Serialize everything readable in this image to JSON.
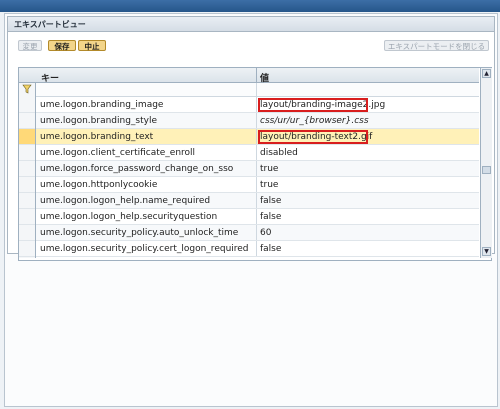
{
  "panel": {
    "title": "エキスパートビュー"
  },
  "toolbar": {
    "change_label": "変更",
    "save_label": "保存",
    "cancel_label": "中止",
    "close_expert_label": "エキスパートモードを閉じる"
  },
  "grid": {
    "columns": {
      "key": "キー",
      "value": "値"
    },
    "rows": [
      {
        "key": "ume.logon.branding_image",
        "value": "layout/branding-image2.jpg"
      },
      {
        "key": "ume.logon.branding_style",
        "value": "css/ur/ur_{browser}.css"
      },
      {
        "key": "ume.logon.branding_text",
        "value": "layout/branding-text2.gif"
      },
      {
        "key": "ume.logon.client_certificate_enroll",
        "value": "disabled"
      },
      {
        "key": "ume.logon.force_password_change_on_sso",
        "value": "true"
      },
      {
        "key": "ume.logon.httponlycookie",
        "value": "true"
      },
      {
        "key": "ume.logon.logon_help.name_required",
        "value": "false"
      },
      {
        "key": "ume.logon.logon_help.securityquestion",
        "value": "false"
      },
      {
        "key": "ume.logon.security_policy.auto_unlock_time",
        "value": "60"
      },
      {
        "key": "ume.logon.security_policy.cert_logon_required",
        "value": "false"
      }
    ]
  },
  "colors": {
    "highlight": "#d81e1e",
    "selected_row": "#fff1b8",
    "accent_button": "#f3d58a"
  }
}
